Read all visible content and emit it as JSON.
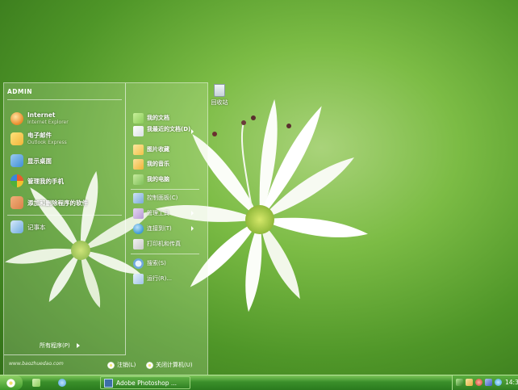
{
  "desktop": {
    "icons": [
      {
        "label": "回收站",
        "icon": "recycle-bin-icon"
      }
    ]
  },
  "start_menu": {
    "user": "ADMIN",
    "pinned": [
      {
        "label": "Internet",
        "sublabel": "Internet Explorer",
        "icon": "globe-icon",
        "color": "#e98a2a"
      },
      {
        "label": "电子邮件",
        "sublabel": "Outlook Express",
        "icon": "mail-icon",
        "color": "#f0b43a"
      }
    ],
    "recent": [
      {
        "label": "显示桌面",
        "icon": "show-desktop-icon",
        "color": "#3f8ed6"
      },
      {
        "label": "管理我的手机",
        "icon": "phone-manager-icon",
        "color": "#e75d2e"
      },
      {
        "label": "添加和删除程序的软件",
        "icon": "add-remove-icon",
        "color": "#d9814a"
      },
      {
        "label": "记事本",
        "icon": "notepad-icon",
        "color": "#6ea9de"
      }
    ],
    "all_programs": "所有程序(P)",
    "right_items": [
      {
        "label": "我的文档",
        "icon": "my-documents-icon",
        "color": "#8bcc5a",
        "bold": true,
        "arrow": false
      },
      {
        "label": "我最近的文档(D)",
        "icon": "recent-documents-icon",
        "color": "#d9dfe4",
        "bold": true,
        "arrow": true
      },
      {
        "label": "图片收藏",
        "icon": "my-pictures-icon",
        "color": "#f0c24a",
        "bold": true,
        "arrow": false
      },
      {
        "label": "我的音乐",
        "icon": "my-music-icon",
        "color": "#f0b43a",
        "bold": true,
        "arrow": false
      },
      {
        "label": "我的电脑",
        "icon": "my-computer-icon",
        "color": "#7fc05a",
        "bold": true,
        "arrow": false
      },
      {
        "label": "控制面板(C)",
        "icon": "control-panel-icon",
        "color": "#7aa9d8",
        "bold": false,
        "arrow": false
      },
      {
        "label": "管理工具",
        "icon": "admin-tools-icon",
        "color": "#b79ad4",
        "bold": false,
        "arrow": true
      },
      {
        "label": "连接到(T)",
        "icon": "connect-to-icon",
        "color": "#3f9ad2",
        "bold": false,
        "arrow": true
      },
      {
        "label": "打印机和传真",
        "icon": "printer-icon",
        "color": "#c9c9c9",
        "bold": false,
        "arrow": false
      },
      {
        "label": "搜索(S)",
        "icon": "search-icon",
        "color": "#6fa8dc",
        "bold": false,
        "arrow": false
      },
      {
        "label": "运行(R)...",
        "icon": "run-icon",
        "color": "#9fc3e6",
        "bold": false,
        "arrow": false
      }
    ],
    "watermark": "www.baozhuedao.com",
    "logoff": "注销(L)",
    "shutdown": "关闭计算机(U)"
  },
  "taskbar": {
    "quick_launch": [
      {
        "icon": "show-desktop-icon",
        "color": "#8bcc5a"
      },
      {
        "icon": "media-player-icon",
        "color": "#4da0e0"
      }
    ],
    "task_button": "Adobe Photoshop ...",
    "tray_icons": [
      {
        "icon": "arrow-icon",
        "color": "#2f7f21"
      },
      {
        "icon": "network-icon",
        "color": "#e0b040"
      },
      {
        "icon": "antivirus-icon",
        "color": "#d94030"
      },
      {
        "icon": "volume-icon",
        "color": "#4060c0"
      },
      {
        "icon": "messenger-icon",
        "color": "#3aa0e0"
      }
    ],
    "clock": "14:36"
  }
}
